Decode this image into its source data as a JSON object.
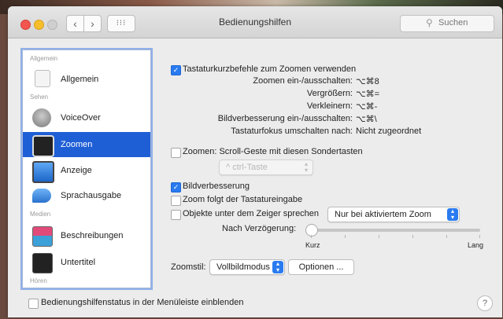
{
  "window": {
    "title": "Bedienungshilfen"
  },
  "toolbar": {
    "back": "‹",
    "forward": "›",
    "grid": "⁝⁝⁝",
    "search_placeholder": "Suchen"
  },
  "sidebar": {
    "sections": [
      "Allgemein",
      "Sehen",
      "Medien",
      "Hören"
    ],
    "items": [
      {
        "label": "Allgemein",
        "icon": "general-icon"
      },
      {
        "label": "VoiceOver",
        "icon": "voiceover-icon"
      },
      {
        "label": "Zoomen",
        "icon": "zoom-icon",
        "selected": true
      },
      {
        "label": "Anzeige",
        "icon": "display-icon"
      },
      {
        "label": "Sprachausgabe",
        "icon": "speech-icon"
      },
      {
        "label": "Beschreibungen",
        "icon": "descriptions-icon"
      },
      {
        "label": "Untertitel",
        "icon": "captions-icon"
      }
    ]
  },
  "zoom": {
    "shortcuts_checkbox": "Tastaturkurzbefehle zum Zoomen verwenden",
    "shortcuts_checked": true,
    "shortcuts": [
      {
        "label": "Zoomen ein-/ausschalten:",
        "key": "⌥⌘8"
      },
      {
        "label": "Vergrößern:",
        "key": "⌥⌘="
      },
      {
        "label": "Verkleinern:",
        "key": "⌥⌘-"
      },
      {
        "label": "Bildverbesserung ein-/ausschalten:",
        "key": "⌥⌘\\"
      },
      {
        "label": "Tastaturfokus umschalten nach:",
        "key": "Nicht zugeordnet"
      }
    ],
    "scroll_checkbox": "Zoomen: Scroll-Geste mit diesen Sondertasten",
    "scroll_checked": false,
    "scroll_key_popup": "^ ctrl-Taste",
    "smoothing_checkbox": "Bildverbesserung",
    "smoothing_checked": true,
    "follow_focus_checkbox": "Zoom folgt der Tastatureingabe",
    "follow_focus_checked": false,
    "speak_items_checkbox": "Objekte unter dem Zeiger sprechen",
    "speak_items_checked": false,
    "speak_items_popup": "Nur bei aktiviertem Zoom",
    "delay_label": "Nach Verzögerung:",
    "delay_value": 0,
    "delay_min_label": "Kurz",
    "delay_max_label": "Lang",
    "style_label": "Zoomstil:",
    "style_popup": "Vollbildmodus",
    "options_button": "Optionen ..."
  },
  "footer": {
    "menubar_checkbox": "Bedienungshilfenstatus in der Menüleiste einblenden",
    "menubar_checked": false,
    "help": "?"
  },
  "colors": {
    "accent": "#2a7bf0",
    "selection": "#1f5fd6"
  }
}
